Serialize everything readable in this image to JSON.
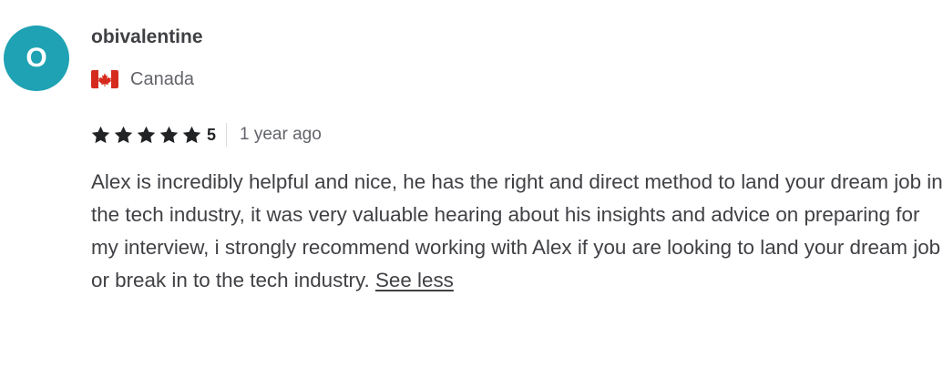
{
  "review": {
    "avatar": {
      "initial": "O",
      "color": "#1fa2b3"
    },
    "username": "obivalentine",
    "country": {
      "flag_icon": "canada-flag-icon",
      "name": "Canada"
    },
    "rating": {
      "stars": 5,
      "star_icon": "star-icon",
      "value_text": "5"
    },
    "time_ago": "1 year ago",
    "text": "Alex is incredibly helpful and nice, he has the right and direct method to land your dream job in the tech industry, it was very valuable hearing about his insights and advice on preparing for my interview, i strongly recommend working with Alex if you are looking to land your dream job or break in to the tech industry.",
    "see_less_label": "See less"
  },
  "colors": {
    "text": "#404145",
    "muted": "#62646a",
    "star": "#222325",
    "flag_red": "#d52b1e"
  }
}
